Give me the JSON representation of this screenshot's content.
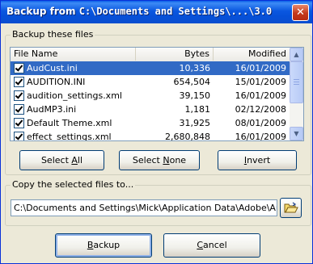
{
  "window": {
    "title_prefix": "Backup from ",
    "title_path": "C:\\Documents and Settings\\...\\3.0",
    "close_glyph": "✕"
  },
  "files_group": {
    "legend": "Backup these files",
    "columns": {
      "name": "File Name",
      "bytes": "Bytes",
      "modified": "Modified"
    },
    "rows": [
      {
        "checked": true,
        "selected": true,
        "name": "AudCust.ini",
        "bytes": "10,336",
        "modified": "16/01/2009"
      },
      {
        "checked": true,
        "selected": false,
        "name": "AUDITION.INI",
        "bytes": "654,504",
        "modified": "15/01/2009"
      },
      {
        "checked": true,
        "selected": false,
        "name": "audition_settings.xml",
        "bytes": "39,150",
        "modified": "16/01/2009"
      },
      {
        "checked": true,
        "selected": false,
        "name": "AudMP3.ini",
        "bytes": "1,181",
        "modified": "02/12/2008"
      },
      {
        "checked": true,
        "selected": false,
        "name": "Default Theme.xml",
        "bytes": "31,925",
        "modified": "08/01/2009"
      },
      {
        "checked": true,
        "selected": false,
        "name": "effect_settings.xml",
        "bytes": "2,680,848",
        "modified": "16/01/2009"
      }
    ],
    "scroll_up_glyph": "▲",
    "scroll_down_glyph": "▼",
    "buttons": {
      "select_all_pre": "Select ",
      "select_all_key": "A",
      "select_all_post": "ll",
      "select_none_pre": "Select ",
      "select_none_key": "N",
      "select_none_post": "one",
      "invert_key": "I",
      "invert_post": "nvert"
    }
  },
  "copy_group": {
    "legend": "Copy the selected files to...",
    "path_value": "C:\\Documents and Settings\\Mick\\Application Data\\Adobe\\Audition",
    "browse_icon": "folder-open-icon"
  },
  "footer": {
    "backup_key": "B",
    "backup_post": "ackup",
    "cancel_key": "C",
    "cancel_post": "ancel"
  },
  "colors": {
    "title_bar": "#0a57e0",
    "selection": "#316ac5",
    "dialog_bg": "#ece9d8",
    "close_button": "#c4391c"
  }
}
